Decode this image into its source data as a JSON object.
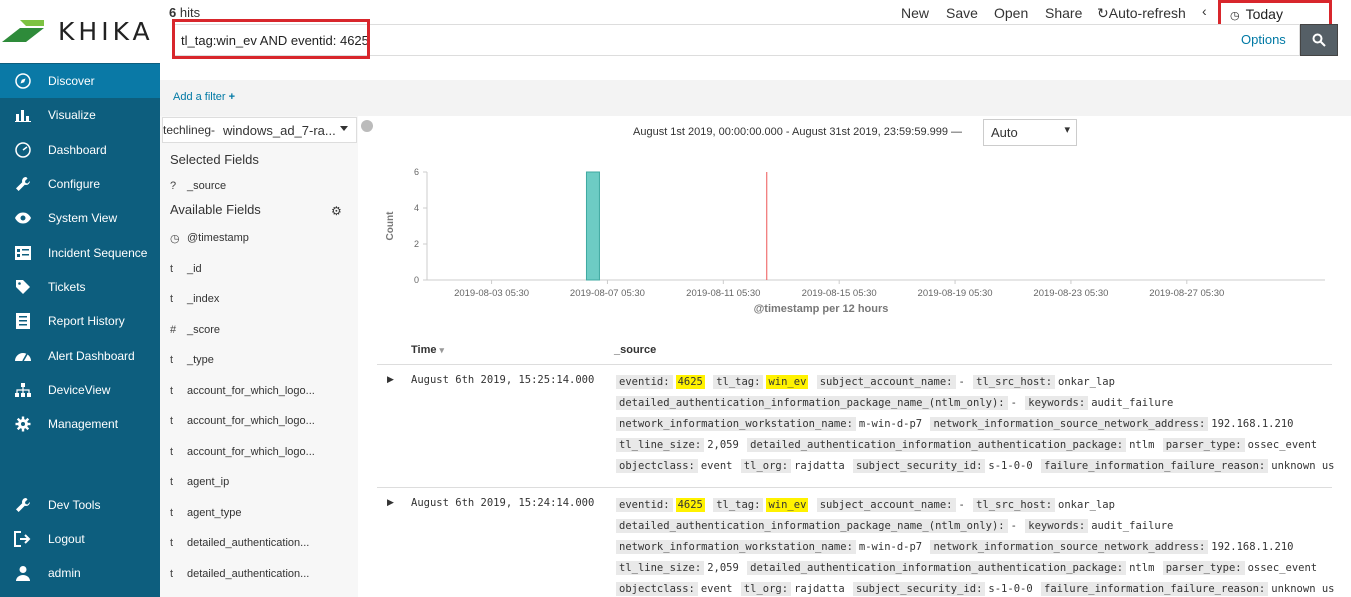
{
  "brand": {
    "logo_text": "KHIKA",
    "accent": "#0d5e7e",
    "highlight": "#fff200",
    "bar_color": "#6dccc4"
  },
  "sidebar": {
    "items": [
      {
        "label": "Discover",
        "icon": "compass-icon",
        "active": true
      },
      {
        "label": "Visualize",
        "icon": "bar-chart-icon"
      },
      {
        "label": "Dashboard",
        "icon": "dashboard-icon"
      },
      {
        "label": "Configure",
        "icon": "wrench-icon"
      },
      {
        "label": "System View",
        "icon": "eye-icon"
      },
      {
        "label": "Incident Sequence",
        "icon": "sequence-icon"
      },
      {
        "label": "Tickets",
        "icon": "tag-icon"
      },
      {
        "label": "Report History",
        "icon": "list-icon"
      },
      {
        "label": "Alert Dashboard",
        "icon": "speedometer-icon"
      },
      {
        "label": "DeviceView",
        "icon": "sitemap-icon"
      },
      {
        "label": "Management",
        "icon": "gear-icon"
      }
    ],
    "bottom_items": [
      {
        "label": "Dev Tools",
        "icon": "wrench-icon"
      },
      {
        "label": "Logout",
        "icon": "logout-icon"
      },
      {
        "label": "admin",
        "icon": "user-icon"
      }
    ]
  },
  "topbar": {
    "hits_count": "6",
    "hits_label": "hits",
    "menu": [
      "New",
      "Save",
      "Open",
      "Share",
      "Auto-refresh"
    ],
    "time_picker": "Today",
    "query": "tl_tag:win_ev AND eventid: 4625",
    "options": "Options",
    "add_filter": "Add a filter"
  },
  "field_panel": {
    "index_prefix": "techlineg-",
    "index_name": "windows_ad_7-ra...",
    "selected_heading": "Selected Fields",
    "selected_fields": [
      {
        "type": "?",
        "name": "_source"
      }
    ],
    "available_heading": "Available Fields",
    "available_fields": [
      {
        "type": "clock",
        "name": "@timestamp"
      },
      {
        "type": "t",
        "name": "_id"
      },
      {
        "type": "t",
        "name": "_index"
      },
      {
        "type": "#",
        "name": "_score"
      },
      {
        "type": "t",
        "name": "_type"
      },
      {
        "type": "t",
        "name": "account_for_which_logo..."
      },
      {
        "type": "t",
        "name": "account_for_which_logo..."
      },
      {
        "type": "t",
        "name": "account_for_which_logo..."
      },
      {
        "type": "t",
        "name": "agent_ip"
      },
      {
        "type": "t",
        "name": "agent_type"
      },
      {
        "type": "t",
        "name": "detailed_authentication..."
      },
      {
        "type": "t",
        "name": "detailed_authentication..."
      }
    ]
  },
  "histogram": {
    "time_range": "August 1st 2019, 00:00:00.000 - August 31st 2019, 23:59:59.999 —",
    "interval": "Auto"
  },
  "chart_data": {
    "type": "bar",
    "ylabel": "Count",
    "xlabel": "@timestamp per 12 hours",
    "x_ticks": [
      "2019-08-03 05:30",
      "2019-08-07 05:30",
      "2019-08-11 05:30",
      "2019-08-15 05:30",
      "2019-08-19 05:30",
      "2019-08-23 05:30",
      "2019-08-27 05:30"
    ],
    "y_ticks": [
      0,
      2,
      4,
      6
    ],
    "ylim": [
      0,
      6
    ],
    "series": [
      {
        "x": "2019-08-06 17:30",
        "value": 6
      }
    ],
    "now_marker": "2019-08-12 17:30"
  },
  "doc_table": {
    "headers": {
      "time": "Time",
      "source": "_source"
    },
    "rows": [
      {
        "time": "August 6th 2019, 15:25:14.000",
        "lines": [
          [
            [
              "eventid:",
              "4625",
              true
            ],
            [
              "tl_tag:",
              "win_ev",
              true
            ],
            [
              "subject_account_name:",
              "-",
              false
            ],
            [
              "tl_src_host:",
              "onkar_lap",
              false
            ]
          ],
          [
            [
              "detailed_authentication_information_package_name_(ntlm_only):",
              "-",
              false
            ],
            [
              "keywords:",
              "audit_failure",
              false
            ]
          ],
          [
            [
              "network_information_workstation_name:",
              "m-win-d-p7",
              false
            ],
            [
              "network_information_source_network_address:",
              "192.168.1.210",
              false
            ]
          ],
          [
            [
              "tl_line_size:",
              "2,059",
              false
            ],
            [
              "detailed_authentication_information_authentication_package:",
              "ntlm",
              false
            ],
            [
              "parser_type:",
              "ossec_event",
              false
            ]
          ],
          [
            [
              "objectclass:",
              "event",
              false
            ],
            [
              "tl_org:",
              "rajdatta",
              false
            ],
            [
              "subject_security_id:",
              "s-1-0-0",
              false
            ],
            [
              "failure_information_failure_reason:",
              "unknown us",
              false
            ]
          ]
        ]
      },
      {
        "time": "August 6th 2019, 15:24:14.000",
        "lines": [
          [
            [
              "eventid:",
              "4625",
              true
            ],
            [
              "tl_tag:",
              "win_ev",
              true
            ],
            [
              "subject_account_name:",
              "-",
              false
            ],
            [
              "tl_src_host:",
              "onkar_lap",
              false
            ]
          ],
          [
            [
              "detailed_authentication_information_package_name_(ntlm_only):",
              "-",
              false
            ],
            [
              "keywords:",
              "audit_failure",
              false
            ]
          ],
          [
            [
              "network_information_workstation_name:",
              "m-win-d-p7",
              false
            ],
            [
              "network_information_source_network_address:",
              "192.168.1.210",
              false
            ]
          ],
          [
            [
              "tl_line_size:",
              "2,059",
              false
            ],
            [
              "detailed_authentication_information_authentication_package:",
              "ntlm",
              false
            ],
            [
              "parser_type:",
              "ossec_event",
              false
            ]
          ],
          [
            [
              "objectclass:",
              "event",
              false
            ],
            [
              "tl_org:",
              "rajdatta",
              false
            ],
            [
              "subject_security_id:",
              "s-1-0-0",
              false
            ],
            [
              "failure_information_failure_reason:",
              "unknown us",
              false
            ]
          ]
        ]
      }
    ]
  }
}
